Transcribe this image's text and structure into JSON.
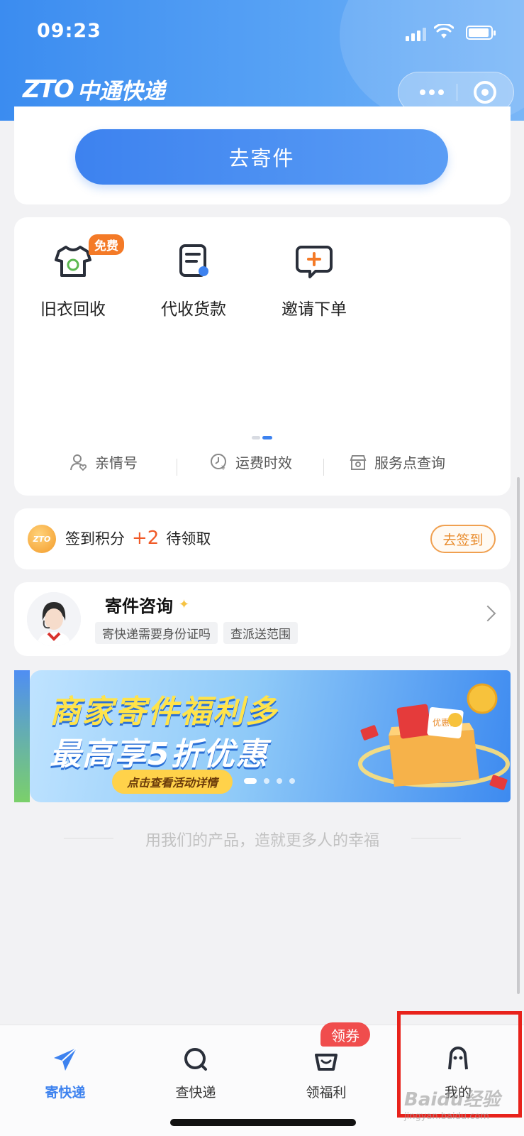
{
  "status_bar": {
    "time": "09:23"
  },
  "header": {
    "logo_mark": "ZTO",
    "logo_text": "中通快递"
  },
  "send_card": {
    "button_label": "去寄件"
  },
  "services": {
    "items": [
      {
        "label": "旧衣回收",
        "icon": "tshirt-recycle-icon",
        "badge": "免费"
      },
      {
        "label": "代收货款",
        "icon": "document-pointer-icon"
      },
      {
        "label": "邀请下单",
        "icon": "chat-plus-icon"
      }
    ],
    "quick_links": [
      {
        "label": "亲情号",
        "icon": "family-person-icon"
      },
      {
        "label": "运费时效",
        "icon": "clock-yen-icon"
      },
      {
        "label": "服务点查询",
        "icon": "store-search-icon"
      }
    ]
  },
  "sign_in": {
    "prefix": "签到积分",
    "points": "+2",
    "suffix": "待领取",
    "button_label": "去签到",
    "coin_text": "ZTO"
  },
  "consult": {
    "title": "寄件咨询",
    "chips": [
      "寄快递需要身份证吗",
      "查派送范围"
    ]
  },
  "banner": {
    "line1": "商家寄件福利多",
    "line2": "最高享5折优惠",
    "cta": "点击查看活动详情",
    "coupon_label": "优惠券"
  },
  "slogan": "用我们的产品，造就更多人的幸福",
  "tabbar": {
    "tabs": [
      {
        "label": "寄快递",
        "icon": "paper-plane-icon",
        "active": true
      },
      {
        "label": "查快递",
        "icon": "search-icon",
        "active": false
      },
      {
        "label": "领福利",
        "icon": "basket-icon",
        "active": false
      },
      {
        "label": "我的",
        "icon": "user-icon",
        "active": false
      }
    ],
    "badge": "领券"
  },
  "watermark": {
    "brand": "Baidu经验",
    "url": "jingyan.baidu.com"
  },
  "colors": {
    "brand_blue": "#3d82ef",
    "accent_orange": "#f47a27",
    "badge_red": "#f04d4d",
    "highlight_red": "#e8221b"
  }
}
